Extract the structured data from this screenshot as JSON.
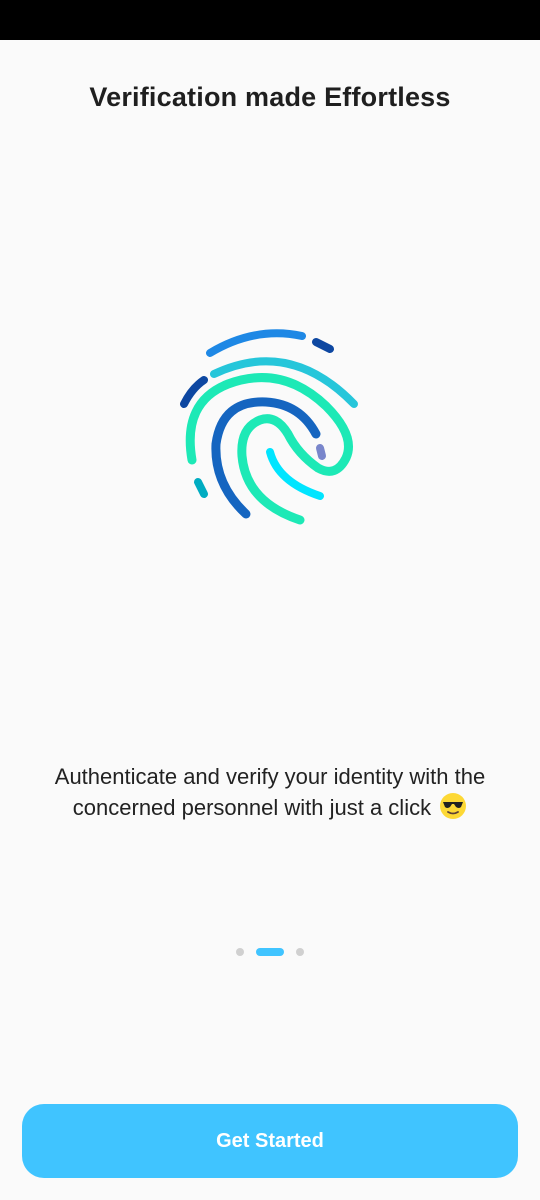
{
  "onboarding": {
    "title": "Verification made Effortless",
    "description": "Authenticate and verify your identity with the concerned personnel with just a click",
    "description_emoji": "sunglasses-emoji-icon",
    "illustration": "fingerprint-icon",
    "pages": {
      "count": 3,
      "current": 2
    },
    "cta_label": "Get Started"
  },
  "colors": {
    "accent": "#40c4ff",
    "background": "#fafafa",
    "title": "#1f1f1f",
    "text": "#222222",
    "dot_inactive": "#d0d0d0",
    "fingerprint": [
      "#1e88e5",
      "#26c6da",
      "#1de9b6",
      "#1565c0",
      "#00e5ff",
      "#0d47a1"
    ]
  }
}
